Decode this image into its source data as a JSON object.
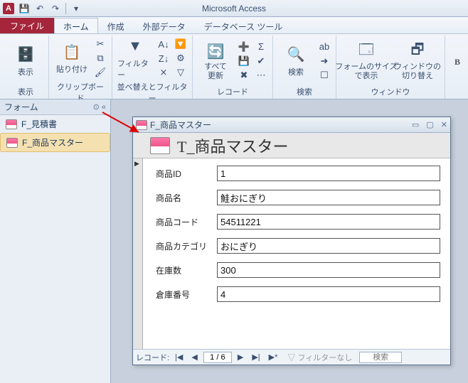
{
  "app": {
    "title": "Microsoft Access",
    "icon_letter": "A"
  },
  "tabs": {
    "file": "ファイル",
    "home": "ホーム",
    "create": "作成",
    "external": "外部データ",
    "dbtools": "データベース ツール"
  },
  "ribbon": {
    "view": {
      "label": "表示",
      "group": "表示"
    },
    "clipboard": {
      "paste": "貼り付け",
      "group": "クリップボード"
    },
    "sort": {
      "filter": "フィルター",
      "group": "並べ替えとフィルター"
    },
    "records": {
      "refresh": "すべて\n更新",
      "group": "レコード"
    },
    "find": {
      "find": "検索",
      "group": "検索"
    },
    "window": {
      "formsize": "フォームのサイズ\nで表示",
      "switch": "ウィンドウの\n切り替え",
      "group": "ウィンドウ"
    }
  },
  "nav": {
    "header": "フォーム",
    "items": [
      "F_見積書",
      "F_商品マスター"
    ]
  },
  "form": {
    "title": "F_商品マスター",
    "header_text": "T_商品マスター",
    "fields": [
      {
        "label": "商品ID",
        "value": "1"
      },
      {
        "label": "商品名",
        "value": "鮭おにぎり"
      },
      {
        "label": "商品コード",
        "value": "54511221"
      },
      {
        "label": "商品カテゴリ",
        "value": "おにぎり"
      },
      {
        "label": "在庫数",
        "value": "300"
      },
      {
        "label": "倉庫番号",
        "value": "4"
      }
    ],
    "record_nav": {
      "label": "レコード:",
      "position": "1 / 6",
      "filter_label": "フィルターなし",
      "search_placeholder": "検索"
    }
  }
}
